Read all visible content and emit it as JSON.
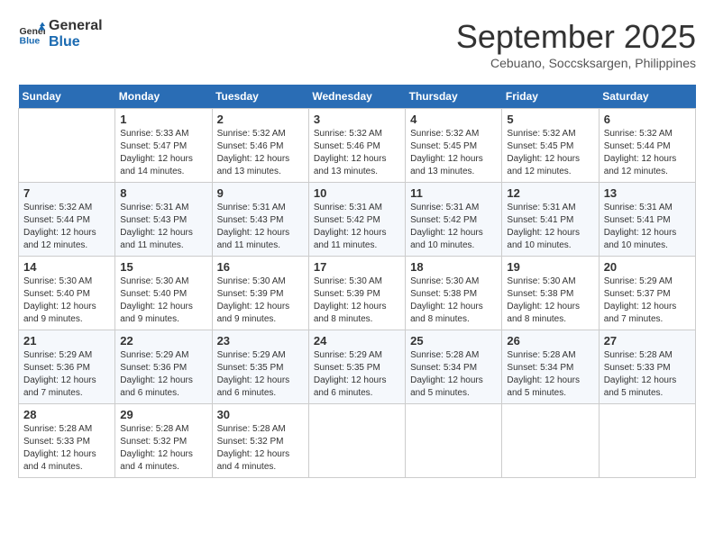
{
  "header": {
    "logo_line1": "General",
    "logo_line2": "Blue",
    "title": "September 2025",
    "subtitle": "Cebuano, Soccsksargen, Philippines"
  },
  "days_of_week": [
    "Sunday",
    "Monday",
    "Tuesday",
    "Wednesday",
    "Thursday",
    "Friday",
    "Saturday"
  ],
  "weeks": [
    [
      {
        "day": "",
        "info": ""
      },
      {
        "day": "1",
        "info": "Sunrise: 5:33 AM\nSunset: 5:47 PM\nDaylight: 12 hours\nand 14 minutes."
      },
      {
        "day": "2",
        "info": "Sunrise: 5:32 AM\nSunset: 5:46 PM\nDaylight: 12 hours\nand 13 minutes."
      },
      {
        "day": "3",
        "info": "Sunrise: 5:32 AM\nSunset: 5:46 PM\nDaylight: 12 hours\nand 13 minutes."
      },
      {
        "day": "4",
        "info": "Sunrise: 5:32 AM\nSunset: 5:45 PM\nDaylight: 12 hours\nand 13 minutes."
      },
      {
        "day": "5",
        "info": "Sunrise: 5:32 AM\nSunset: 5:45 PM\nDaylight: 12 hours\nand 12 minutes."
      },
      {
        "day": "6",
        "info": "Sunrise: 5:32 AM\nSunset: 5:44 PM\nDaylight: 12 hours\nand 12 minutes."
      }
    ],
    [
      {
        "day": "7",
        "info": "Sunrise: 5:32 AM\nSunset: 5:44 PM\nDaylight: 12 hours\nand 12 minutes."
      },
      {
        "day": "8",
        "info": "Sunrise: 5:31 AM\nSunset: 5:43 PM\nDaylight: 12 hours\nand 11 minutes."
      },
      {
        "day": "9",
        "info": "Sunrise: 5:31 AM\nSunset: 5:43 PM\nDaylight: 12 hours\nand 11 minutes."
      },
      {
        "day": "10",
        "info": "Sunrise: 5:31 AM\nSunset: 5:42 PM\nDaylight: 12 hours\nand 11 minutes."
      },
      {
        "day": "11",
        "info": "Sunrise: 5:31 AM\nSunset: 5:42 PM\nDaylight: 12 hours\nand 10 minutes."
      },
      {
        "day": "12",
        "info": "Sunrise: 5:31 AM\nSunset: 5:41 PM\nDaylight: 12 hours\nand 10 minutes."
      },
      {
        "day": "13",
        "info": "Sunrise: 5:31 AM\nSunset: 5:41 PM\nDaylight: 12 hours\nand 10 minutes."
      }
    ],
    [
      {
        "day": "14",
        "info": "Sunrise: 5:30 AM\nSunset: 5:40 PM\nDaylight: 12 hours\nand 9 minutes."
      },
      {
        "day": "15",
        "info": "Sunrise: 5:30 AM\nSunset: 5:40 PM\nDaylight: 12 hours\nand 9 minutes."
      },
      {
        "day": "16",
        "info": "Sunrise: 5:30 AM\nSunset: 5:39 PM\nDaylight: 12 hours\nand 9 minutes."
      },
      {
        "day": "17",
        "info": "Sunrise: 5:30 AM\nSunset: 5:39 PM\nDaylight: 12 hours\nand 8 minutes."
      },
      {
        "day": "18",
        "info": "Sunrise: 5:30 AM\nSunset: 5:38 PM\nDaylight: 12 hours\nand 8 minutes."
      },
      {
        "day": "19",
        "info": "Sunrise: 5:30 AM\nSunset: 5:38 PM\nDaylight: 12 hours\nand 8 minutes."
      },
      {
        "day": "20",
        "info": "Sunrise: 5:29 AM\nSunset: 5:37 PM\nDaylight: 12 hours\nand 7 minutes."
      }
    ],
    [
      {
        "day": "21",
        "info": "Sunrise: 5:29 AM\nSunset: 5:36 PM\nDaylight: 12 hours\nand 7 minutes."
      },
      {
        "day": "22",
        "info": "Sunrise: 5:29 AM\nSunset: 5:36 PM\nDaylight: 12 hours\nand 6 minutes."
      },
      {
        "day": "23",
        "info": "Sunrise: 5:29 AM\nSunset: 5:35 PM\nDaylight: 12 hours\nand 6 minutes."
      },
      {
        "day": "24",
        "info": "Sunrise: 5:29 AM\nSunset: 5:35 PM\nDaylight: 12 hours\nand 6 minutes."
      },
      {
        "day": "25",
        "info": "Sunrise: 5:28 AM\nSunset: 5:34 PM\nDaylight: 12 hours\nand 5 minutes."
      },
      {
        "day": "26",
        "info": "Sunrise: 5:28 AM\nSunset: 5:34 PM\nDaylight: 12 hours\nand 5 minutes."
      },
      {
        "day": "27",
        "info": "Sunrise: 5:28 AM\nSunset: 5:33 PM\nDaylight: 12 hours\nand 5 minutes."
      }
    ],
    [
      {
        "day": "28",
        "info": "Sunrise: 5:28 AM\nSunset: 5:33 PM\nDaylight: 12 hours\nand 4 minutes."
      },
      {
        "day": "29",
        "info": "Sunrise: 5:28 AM\nSunset: 5:32 PM\nDaylight: 12 hours\nand 4 minutes."
      },
      {
        "day": "30",
        "info": "Sunrise: 5:28 AM\nSunset: 5:32 PM\nDaylight: 12 hours\nand 4 minutes."
      },
      {
        "day": "",
        "info": ""
      },
      {
        "day": "",
        "info": ""
      },
      {
        "day": "",
        "info": ""
      },
      {
        "day": "",
        "info": ""
      }
    ]
  ]
}
